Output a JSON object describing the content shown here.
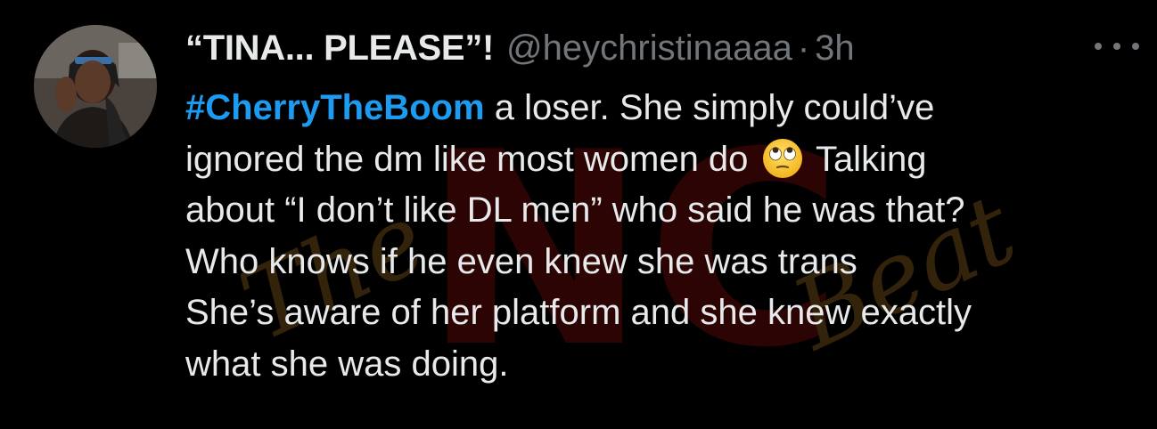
{
  "tweet": {
    "display_name": "“TINA... PLEASE”!",
    "handle": "@heychristinaaaa",
    "separator": "·",
    "time": "3h",
    "more_icon": "more-horizontal-icon",
    "avatar_icon": "profile-photo",
    "lines": {
      "l1_hashtag": "#CherryTheBoom",
      "l1_rest": " a loser. She simply could’ve",
      "l2_a": "ignored the dm like most women do ",
      "l2_b": " Talking",
      "l3": "about “I don’t like DL men” who said he was that?",
      "l4": "Who knows if he even knew she was trans",
      "l5": "She’s aware of her platform and she knew exactly",
      "l6": "what she was doing."
    },
    "emoji_icon": "eye-roll-emoji-icon",
    "colors": {
      "background": "#000000",
      "text": "#e7e9ea",
      "muted": "#71767b",
      "link": "#1d9bf0"
    }
  },
  "watermark": {
    "logo": "The NC Beat"
  }
}
